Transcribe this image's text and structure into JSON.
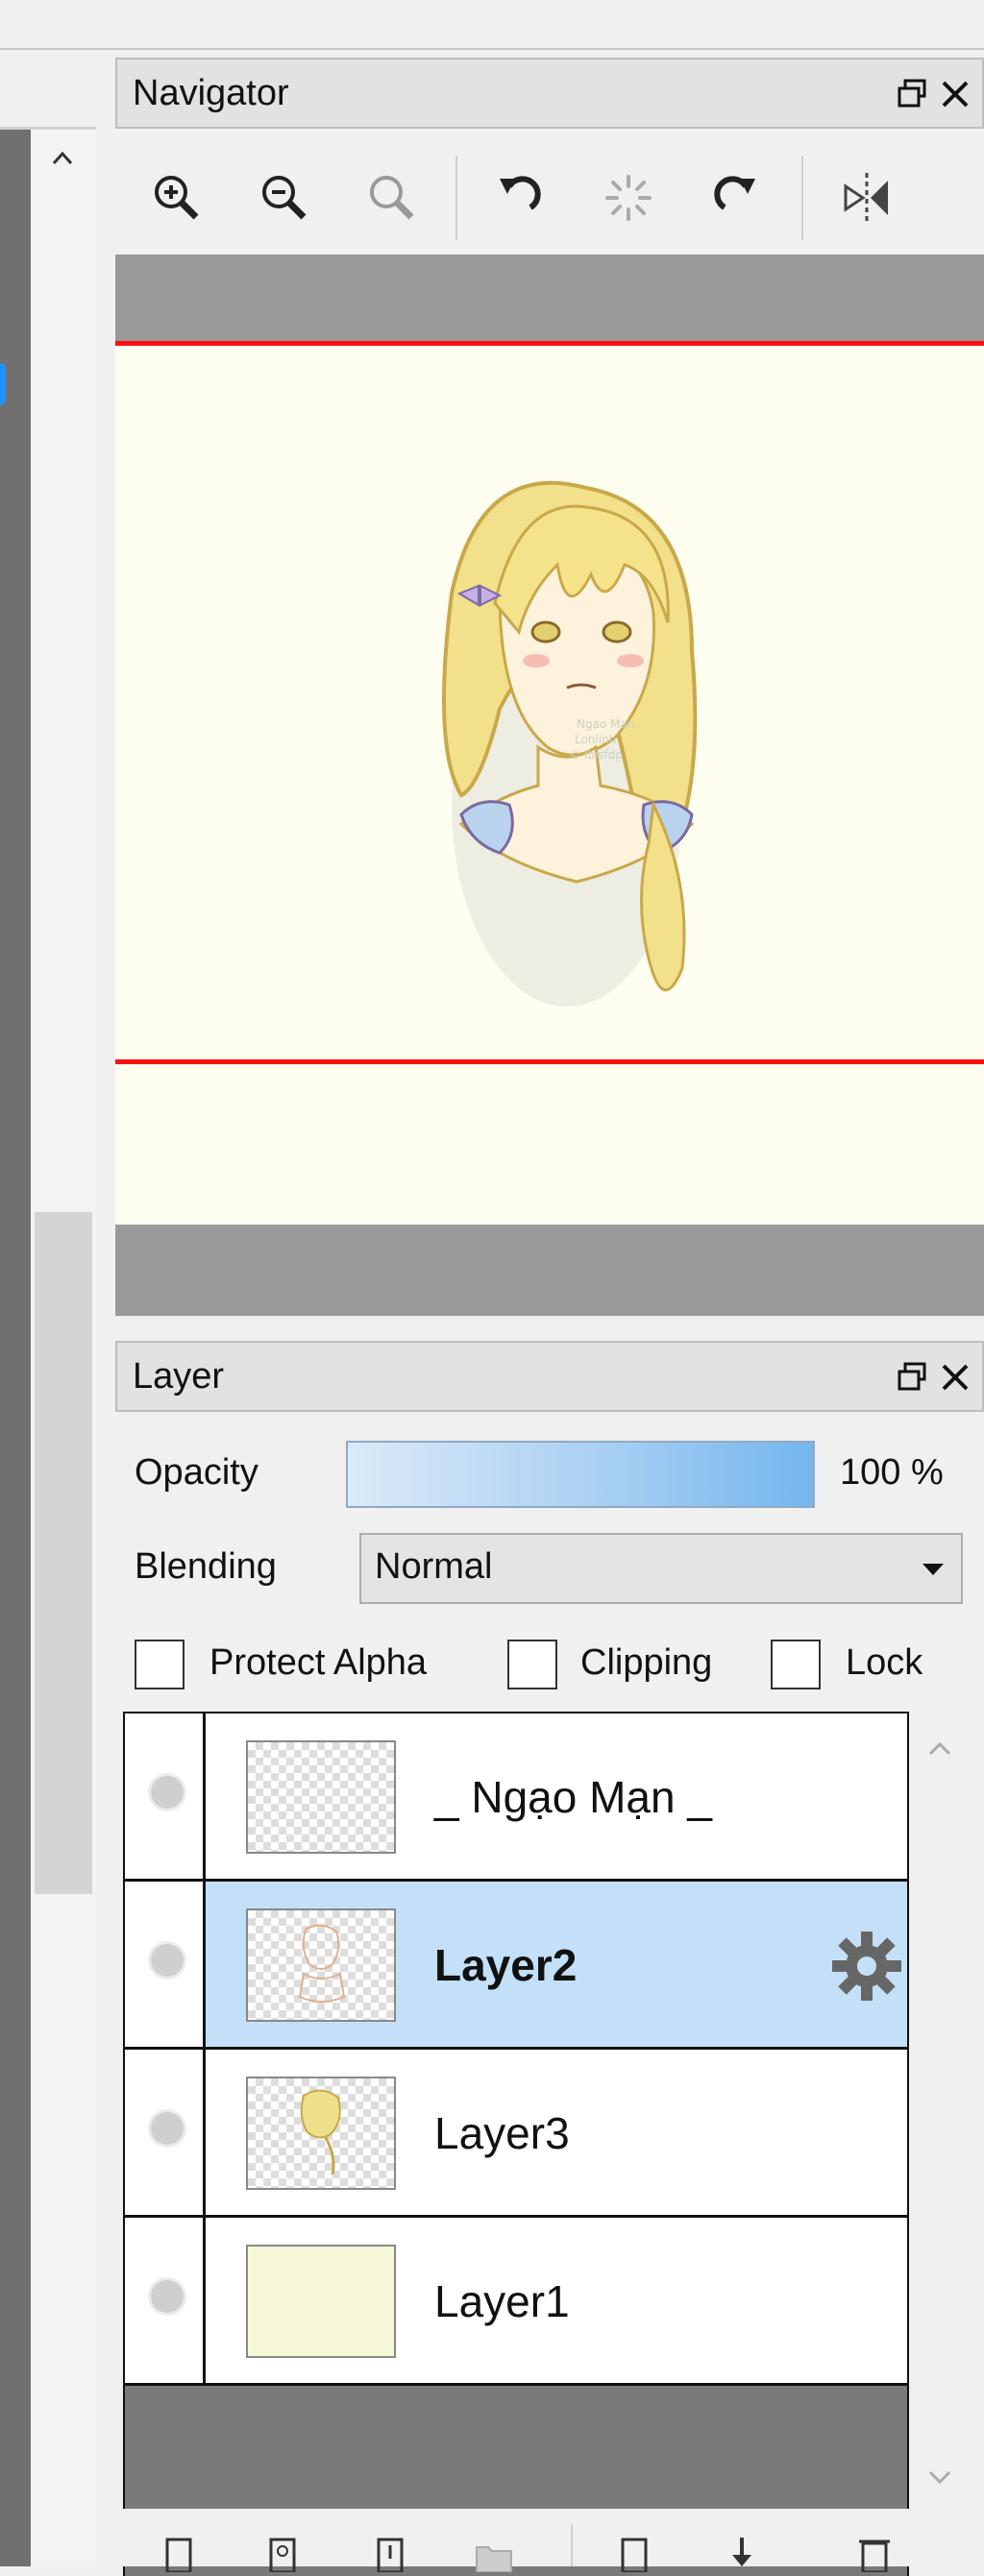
{
  "navigator": {
    "title": "Navigator",
    "toolbar": [
      "zoom-in",
      "zoom-out",
      "zoom-reset",
      "rotate-left",
      "rotate-reset",
      "rotate-right",
      "flip-horizontal"
    ]
  },
  "layer_panel": {
    "title": "Layer",
    "opacity_label": "Opacity",
    "opacity_value": "100 %",
    "blending_label": "Blending",
    "blending_value": "Normal",
    "protect_alpha_label": "Protect Alpha",
    "clipping_label": "Clipping",
    "lock_label": "Lock",
    "layers": [
      {
        "name": "_ Ngạo Mạn _",
        "selected": false
      },
      {
        "name": "Layer2",
        "selected": true
      },
      {
        "name": "Layer3",
        "selected": false
      },
      {
        "name": "Layer1",
        "selected": false
      }
    ]
  },
  "colors": {
    "selection": "#c3e0f8",
    "frame_line": "#ff1010",
    "canvas_bg": "#fdfdf0"
  }
}
